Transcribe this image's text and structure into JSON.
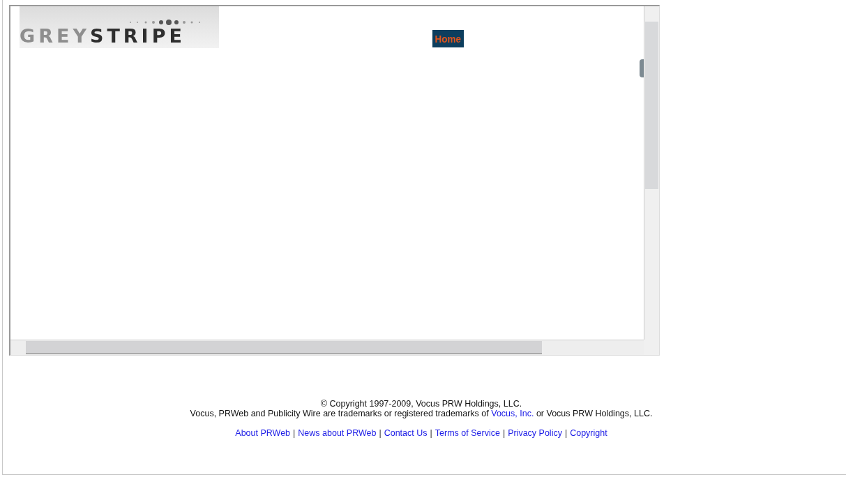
{
  "frame": {
    "logo": {
      "light": "GREY",
      "dark": "STRIPE"
    },
    "nav_button": "Home"
  },
  "footer": {
    "copyright": "© Copyright 1997-2009, Vocus PRW Holdings, LLC.",
    "trademark": {
      "before": "Vocus, PRWeb and Publicity Wire are trademarks or registered trademarks of",
      "link": "Vocus, Inc.",
      "after": "or Vocus PRW Holdings, LLC."
    },
    "separator": "|",
    "links": [
      "About PRWeb",
      "News about PRWeb",
      "Contact Us",
      "Terms of Service",
      "Privacy Policy",
      "Copyright"
    ]
  }
}
